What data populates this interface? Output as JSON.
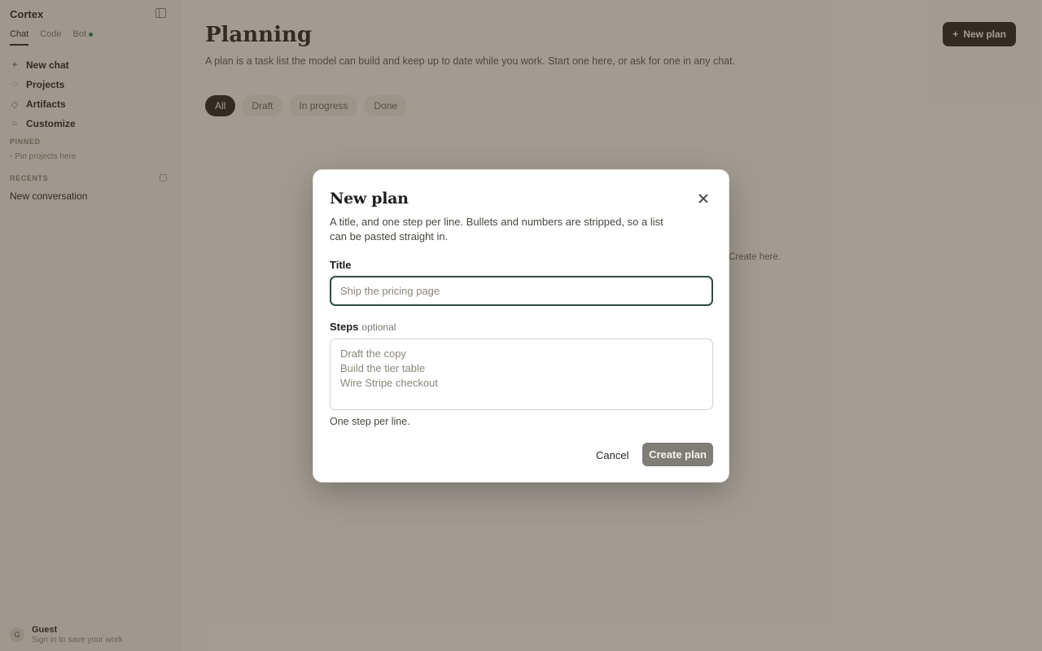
{
  "sidebar": {
    "app_title": "Cortex",
    "modes": [
      {
        "label": "Chat",
        "active": true
      },
      {
        "label": "Code",
        "active": false
      },
      {
        "label": "Bot",
        "active": false
      }
    ],
    "nav": [
      {
        "label": "New chat",
        "icon": "plus-icon"
      },
      {
        "label": "Projects",
        "icon": "chat-bubble-icon"
      },
      {
        "label": "Artifacts",
        "icon": "artifact-icon"
      },
      {
        "label": "Customize",
        "icon": "customize-icon"
      }
    ],
    "pinned_label": "PINNED",
    "pinned_hint": "Pin projects here",
    "recents_label": "RECENTS",
    "recents": [
      "New conversation"
    ],
    "user": {
      "name": "Guest",
      "subtitle": "Sign in to save your work",
      "avatar": "G"
    }
  },
  "main": {
    "title": "Planning",
    "description": "A plan is a task list the model can build and keep up to date while you work. Start one here, or ask for one in any chat.",
    "filters": [
      "All",
      "Draft",
      "In progress",
      "Done"
    ],
    "active_filter": "All",
    "new_plan_label": "New plan",
    "empty_text": "Create here."
  },
  "modal": {
    "title": "New plan",
    "description": "A title, and one step per line. Bullets and numbers are stripped, so a list can be pasted straight in.",
    "title_label": "Title",
    "title_placeholder": "Ship the pricing page",
    "title_value": "",
    "steps_label": "Steps",
    "steps_optional": "optional",
    "steps_placeholder": "Draft the copy\nBuild the tier table\nWire Stripe checkout",
    "steps_value": "",
    "help_text": "One step per line.",
    "cancel_label": "Cancel",
    "create_label": "Create plan"
  },
  "colors": {
    "accent_dark": "#2a2620",
    "focus_ring": "#2f4a45",
    "create_disabled": "#807c77",
    "status_online": "#2e7d4f"
  }
}
